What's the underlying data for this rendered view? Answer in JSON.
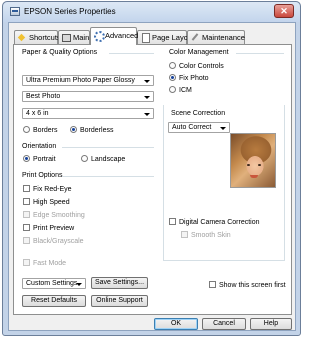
{
  "window": {
    "title": "EPSON Series Properties",
    "close_glyph": "✕"
  },
  "tabs": [
    {
      "label": "Shortcuts",
      "icon": "shortcut-icon"
    },
    {
      "label": "Main",
      "icon": "main-icon"
    },
    {
      "label": "Advanced",
      "icon": "advanced-icon",
      "active": true
    },
    {
      "label": "Page Layout",
      "icon": "page-layout-icon"
    },
    {
      "label": "Maintenance",
      "icon": "maintenance-icon"
    }
  ],
  "paper_quality": {
    "group_label": "Paper & Quality Options",
    "paper_type": "Ultra Premium Photo Paper Glossy",
    "quality": "Best Photo",
    "size": "4 x 6 in",
    "borders_label": "Borders",
    "borderless_label": "Borderless",
    "borderless_selected": true
  },
  "orientation": {
    "group_label": "Orientation",
    "portrait_label": "Portrait",
    "landscape_label": "Landscape",
    "portrait_selected": true
  },
  "print_options": {
    "group_label": "Print Options",
    "items": [
      {
        "label": "Fix Red-Eye",
        "enabled": true
      },
      {
        "label": "High Speed",
        "enabled": true
      },
      {
        "label": "Edge Smoothing",
        "enabled": false
      },
      {
        "label": "Print Preview",
        "enabled": true
      },
      {
        "label": "Black/Grayscale",
        "enabled": false
      },
      {
        "label": "Fast Mode",
        "enabled": false
      }
    ]
  },
  "color_management": {
    "group_label": "Color Management",
    "options": [
      "Color Controls",
      "Fix Photo",
      "ICM"
    ],
    "selected": "Fix Photo"
  },
  "scene_correction": {
    "label": "Scene Correction",
    "value": "Auto Correct"
  },
  "digital_camera_correction": "Digital Camera Correction",
  "smooth_skin": "Smooth Skin",
  "bottom": {
    "settings_value": "Custom Settings",
    "save_settings": "Save Settings...",
    "reset_defaults": "Reset Defaults",
    "online_support": "Online Support",
    "show_first": "Show this screen first"
  },
  "dialog_buttons": {
    "ok": "OK",
    "cancel": "Cancel",
    "help": "Help"
  },
  "colors": {
    "title_bar": "#c3d5ec",
    "close_button": "#c9483c",
    "accent": "#17439b"
  }
}
